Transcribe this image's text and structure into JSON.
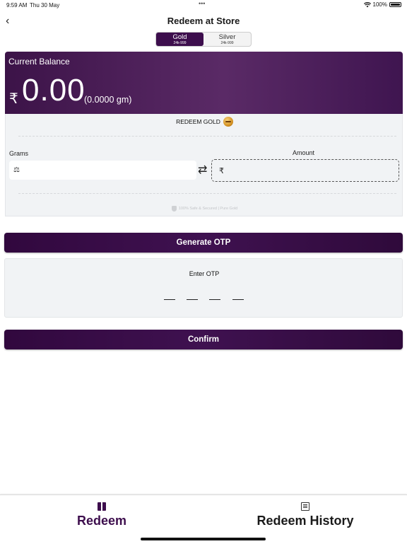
{
  "status": {
    "time": "9:59 AM",
    "date": "Thu 30 May",
    "battery": "100%"
  },
  "header": {
    "title": "Redeem at Store"
  },
  "metal_toggle": [
    {
      "label": "Gold",
      "sub": "24k-999",
      "selected": true
    },
    {
      "label": "Silver",
      "sub": "24k-999",
      "selected": false
    }
  ],
  "balance": {
    "label": "Current Balance",
    "currency": "₹",
    "amount": "0.00",
    "grams": "(0.0000 gm)"
  },
  "redeem": {
    "heading": "REDEEM GOLD",
    "grams_label": "Grams",
    "amount_label": "Amount",
    "grams_value": "",
    "amount_currency": "₹",
    "amount_value": "",
    "safe_note": "100% Safe & Secured | Pure Gold"
  },
  "generate_otp_label": "Generate OTP",
  "otp": {
    "label": "Enter OTP",
    "slots": [
      "",
      "",
      "",
      ""
    ]
  },
  "confirm_label": "Confirm",
  "tabs": [
    {
      "label": "Redeem",
      "icon": "gift-icon",
      "active": true
    },
    {
      "label": "Redeem History",
      "icon": "book-icon",
      "active": false
    }
  ],
  "colors": {
    "brand": "#3d0e4d",
    "panel": "#f1f3f5"
  }
}
